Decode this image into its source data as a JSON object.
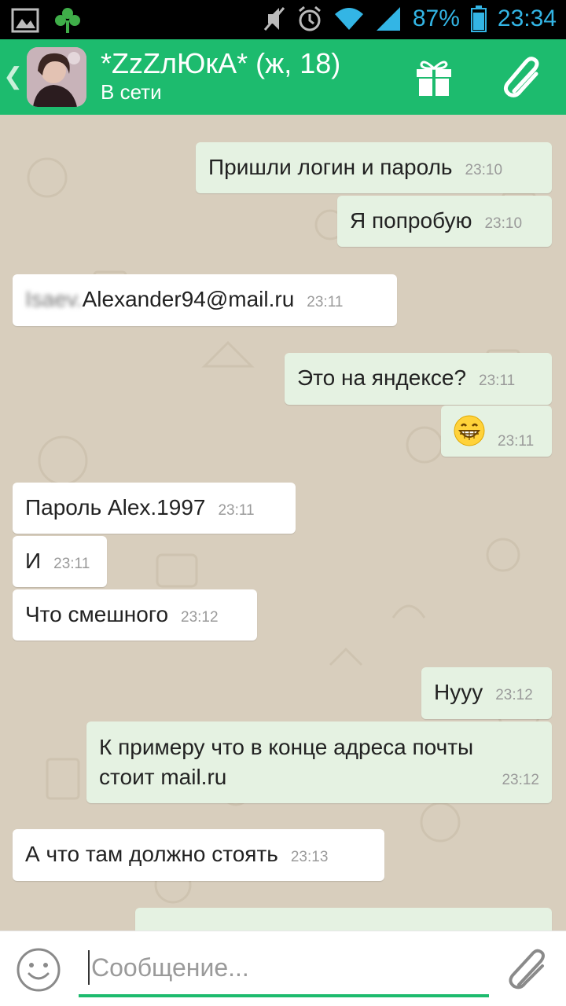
{
  "statusbar": {
    "battery": "87%",
    "time": "23:34"
  },
  "header": {
    "back_icon": "chevron-left-icon",
    "title": "*ZzZлЮкА* (ж, 18)",
    "status": "В сети",
    "gift_icon": "gift-icon",
    "attach_icon": "paperclip-icon"
  },
  "messages": [
    {
      "dir": "out",
      "text": "Пришли логин и пароль",
      "time": "23:10"
    },
    {
      "dir": "out",
      "text": "Я попробую",
      "time": "23:10"
    },
    {
      "dir": "in",
      "text_blurred": "Isaev.",
      "text": "Alexander94@mail.ru",
      "time": "23:11"
    },
    {
      "dir": "out",
      "text": "Это на яндексе?",
      "time": "23:11"
    },
    {
      "dir": "out",
      "emoji": "grinning-face-emoji",
      "time": "23:11"
    },
    {
      "dir": "in",
      "text": "Пароль Alex.1997",
      "time": "23:11"
    },
    {
      "dir": "in",
      "text": "И",
      "time": "23:11"
    },
    {
      "dir": "in",
      "text": "Что смешного",
      "time": "23:12"
    },
    {
      "dir": "out",
      "text": "Нууу",
      "time": "23:12"
    },
    {
      "dir": "out",
      "text_line1": "К примеру что в конце адреса почты",
      "text_line2": "стоит mail.ru",
      "time": "23:12"
    },
    {
      "dir": "in",
      "text": "А что там должно стоять",
      "time": "23:13"
    },
    {
      "dir": "out",
      "text": "",
      "time": ""
    }
  ],
  "input": {
    "placeholder": "Сообщение...",
    "emoji_icon": "smiley-icon",
    "attach_icon": "paperclip-icon"
  },
  "colors": {
    "header": "#1dbb6e",
    "background": "#d8cebd",
    "outgoing_bubble": "#e5f2e2",
    "incoming_bubble": "#ffffff",
    "statusbar_icons": "#33b5e5"
  }
}
